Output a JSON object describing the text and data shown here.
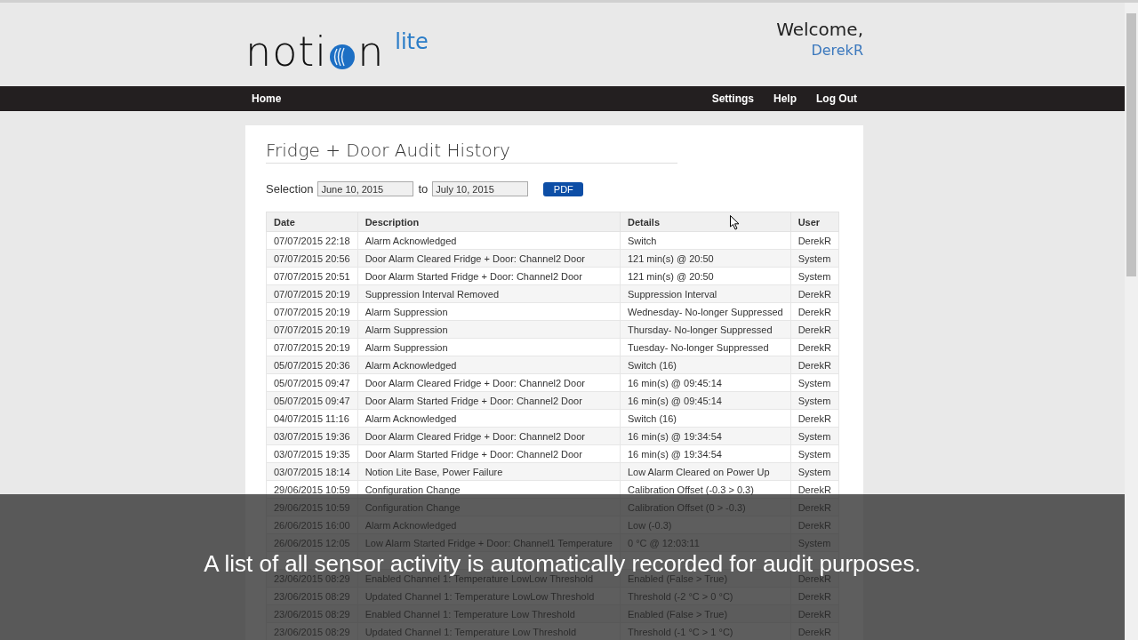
{
  "logo": {
    "before": "noti",
    "after": "n",
    "suffix": "lite"
  },
  "welcome": {
    "greeting": "Welcome,",
    "user": "DerekR"
  },
  "nav": {
    "left": [
      "Home"
    ],
    "right": [
      "Settings",
      "Help",
      "Log Out"
    ]
  },
  "page": {
    "title": "Fridge + Door Audit History",
    "selection_label": "Selection",
    "from": "June 10, 2015",
    "to_label": "to",
    "to": "July 10, 2015",
    "pdf_button": "PDF"
  },
  "table": {
    "columns": [
      "Date",
      "Description",
      "Details",
      "User"
    ],
    "rows": [
      [
        "07/07/2015 22:18",
        "Alarm Acknowledged",
        "Switch",
        "DerekR"
      ],
      [
        "07/07/2015 20:56",
        "Door Alarm Cleared Fridge + Door: Channel2 Door",
        "121 min(s) @ 20:50",
        "System"
      ],
      [
        "07/07/2015 20:51",
        "Door Alarm Started Fridge + Door: Channel2 Door",
        "121 min(s) @ 20:50",
        "System"
      ],
      [
        "07/07/2015 20:19",
        "Suppression Interval Removed",
        "Suppression Interval",
        "DerekR"
      ],
      [
        "07/07/2015 20:19",
        "Alarm Suppression",
        "Wednesday- No-longer Suppressed",
        "DerekR"
      ],
      [
        "07/07/2015 20:19",
        "Alarm Suppression",
        "Thursday- No-longer Suppressed",
        "DerekR"
      ],
      [
        "07/07/2015 20:19",
        "Alarm Suppression",
        "Tuesday- No-longer Suppressed",
        "DerekR"
      ],
      [
        "05/07/2015 20:36",
        "Alarm Acknowledged",
        "Switch (16)",
        "DerekR"
      ],
      [
        "05/07/2015 09:47",
        "Door Alarm Cleared Fridge + Door: Channel2 Door",
        "16 min(s) @ 09:45:14",
        "System"
      ],
      [
        "05/07/2015 09:47",
        "Door Alarm Started Fridge + Door: Channel2 Door",
        "16 min(s) @ 09:45:14",
        "System"
      ],
      [
        "04/07/2015 11:16",
        "Alarm Acknowledged",
        "Switch (16)",
        "DerekR"
      ],
      [
        "03/07/2015 19:36",
        "Door Alarm Cleared Fridge + Door: Channel2 Door",
        "16 min(s) @ 19:34:54",
        "System"
      ],
      [
        "03/07/2015 19:35",
        "Door Alarm Started Fridge + Door: Channel2 Door",
        "16 min(s) @ 19:34:54",
        "System"
      ],
      [
        "03/07/2015 18:14",
        "Notion Lite Base, Power Failure",
        "Low Alarm Cleared on Power Up",
        "System"
      ],
      [
        "29/06/2015 10:59",
        "Configuration Change",
        "Calibration Offset (-0.3 > 0.3)",
        "DerekR"
      ],
      [
        "29/06/2015 10:59",
        "Configuration Change",
        "Calibration Offset (0 > -0.3)",
        "DerekR"
      ],
      [
        "26/06/2015 16:00",
        "Alarm Acknowledged",
        "Low (-0.3)",
        "DerekR"
      ],
      [
        "26/06/2015 12:05",
        "Low Alarm Started Fridge + Door: Channel1 Temperature",
        "0 °C @ 12:03:11",
        "System"
      ],
      {
        "kind": "covered"
      },
      [
        "23/06/2015 08:29",
        "Enabled Channel 1: Temperature LowLow Threshold",
        "Enabled (False > True)",
        "DerekR"
      ],
      [
        "23/06/2015 08:29",
        "Updated Channel 1: Temperature LowLow Threshold",
        "Threshold (-2 °C > 0 °C)",
        "DerekR"
      ],
      [
        "23/06/2015 08:29",
        "Enabled Channel 1: Temperature Low Threshold",
        "Enabled (False > True)",
        "DerekR"
      ],
      [
        "23/06/2015 08:29",
        "Updated Channel 1: Temperature Low Threshold",
        "Threshold (-1 °C > 1 °C)",
        "DerekR"
      ]
    ]
  },
  "caption": "A list of all sensor activity is automatically recorded for audit purposes."
}
